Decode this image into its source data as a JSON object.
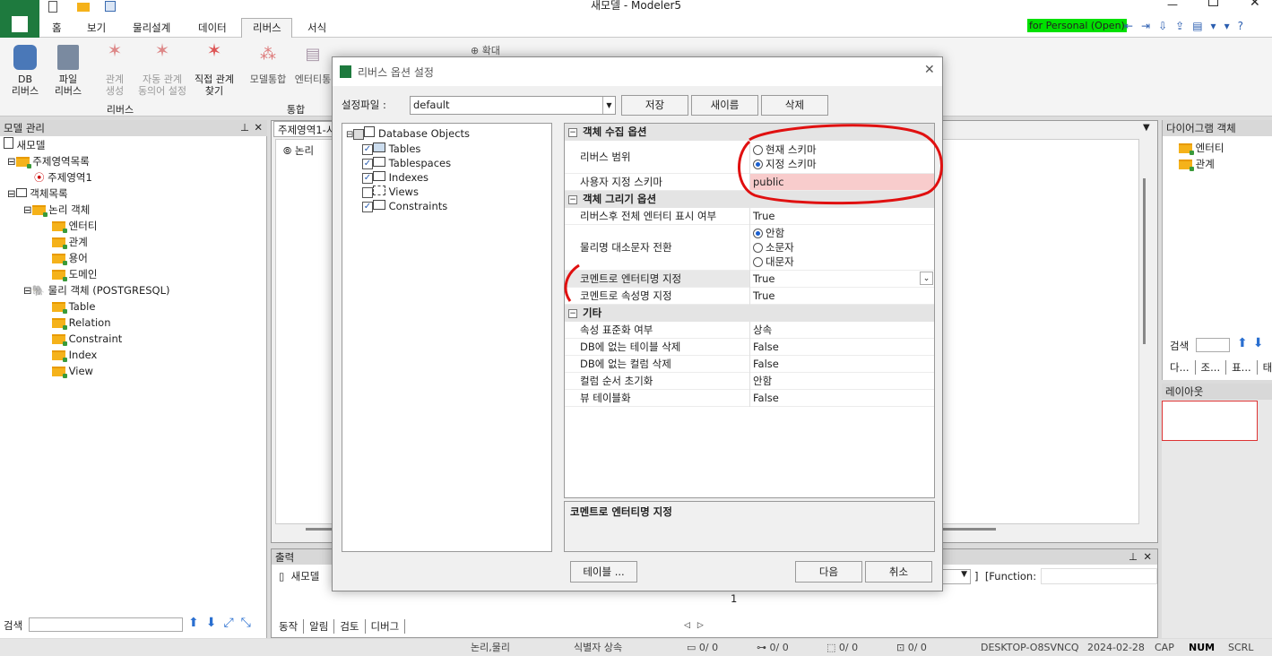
{
  "window": {
    "title": "새모델 - Modeler5",
    "license": "for Personal (Open)"
  },
  "menu": [
    "홈",
    "보기",
    "물리설계",
    "데이터",
    "리버스",
    "서식"
  ],
  "ribbon": {
    "groups": [
      {
        "label": "리버스"
      },
      {
        "label": "통합"
      }
    ],
    "buttons": [
      "DB\n리버스",
      "파일\n리버스",
      "관계\n생성",
      "자동 관계\n동의어 설정",
      "직접 관계\n찾기",
      "모델통합",
      "엔터티통"
    ],
    "zoom": "확대"
  },
  "left_panel": {
    "title": "모델 관리",
    "tree": [
      {
        "label": "새모델",
        "indent": 0
      },
      {
        "label": "주제영역목록",
        "indent": 1
      },
      {
        "label": "주제영역1",
        "indent": 2
      },
      {
        "label": "객체목록",
        "indent": 1
      },
      {
        "label": "논리 객체",
        "indent": 2
      },
      {
        "label": "엔터티",
        "indent": 3
      },
      {
        "label": "관계",
        "indent": 3
      },
      {
        "label": "용어",
        "indent": 3
      },
      {
        "label": "도메인",
        "indent": 3
      },
      {
        "label": "물리 객체 (POSTGRESQL)",
        "indent": 2
      },
      {
        "label": "Table",
        "indent": 3
      },
      {
        "label": "Relation",
        "indent": 3
      },
      {
        "label": "Constraint",
        "indent": 3
      },
      {
        "label": "Index",
        "indent": 3
      },
      {
        "label": "View",
        "indent": 3
      }
    ],
    "search_label": "검색"
  },
  "center": {
    "tab": "주제영역1-시",
    "item": "논리"
  },
  "output": {
    "title": "출력",
    "item": "새모델",
    "tabs": [
      "동작",
      "알림",
      "검토",
      "디버그"
    ],
    "function_label": "[Function:",
    "line": "1"
  },
  "right_panel": {
    "title": "다이어그램 객체",
    "items": [
      "엔터티",
      "관계"
    ],
    "search_label": "검색",
    "tabs": [
      "다...",
      "조...",
      "표...",
      "태..."
    ],
    "layout_title": "레이아웃"
  },
  "statusbar": {
    "mode": "논리,물리",
    "inherit": "식별자 상속",
    "c1": "0/ 0",
    "c2": "0/ 0",
    "c3": "0/ 0",
    "c4": "0/ 0",
    "host": "DESKTOP-O8SVNCQ",
    "date": "2024-02-28",
    "cap": "CAP",
    "num": "NUM",
    "scrl": "SCRL"
  },
  "dialog": {
    "title": "리버스 옵션 설정",
    "profile_label": "설정파일 :",
    "profile_value": "default",
    "save": "저장",
    "rename": "새이름",
    "delete": "삭제",
    "objects_root": "Database Objects",
    "objects": [
      {
        "label": "Tables",
        "checked": true
      },
      {
        "label": "Tablespaces",
        "checked": true
      },
      {
        "label": "Indexes",
        "checked": true
      },
      {
        "label": "Views",
        "checked": false
      },
      {
        "label": "Constraints",
        "checked": true
      }
    ],
    "sections": {
      "collect": "객체 수집 옵션",
      "draw": "객체 그리기 옵션",
      "etc": "기타"
    },
    "props": {
      "reverse_scope": "리버스 범위",
      "scope_opts": [
        "현재 스키마",
        "지정 스키마"
      ],
      "user_schema": "사용자 지정 스키마",
      "user_schema_val": "public",
      "show_all": "리버스후 전체 엔터티 표시 여부",
      "show_all_val": "True",
      "case": "물리명 대소문자 전환",
      "case_opts": [
        "안함",
        "소문자",
        "대문자"
      ],
      "comment_entity": "코멘트로 엔터티명 지정",
      "comment_entity_val": "True",
      "comment_attr": "코멘트로 속성명 지정",
      "comment_attr_val": "True",
      "standard": "속성 표준화 여부",
      "standard_val": "상속",
      "del_table": "DB에 없는 테이블 삭제",
      "del_table_val": "False",
      "del_col": "DB에 없는 컬럼 삭제",
      "del_col_val": "False",
      "col_order": "컬럼 순서 초기화",
      "col_order_val": "안함",
      "view_table": "뷰 테이블화",
      "view_table_val": "False"
    },
    "description": "코멘트로 엔터티명 지정",
    "table_btn": "테이블 ...",
    "next": "다음",
    "cancel": "취소"
  }
}
